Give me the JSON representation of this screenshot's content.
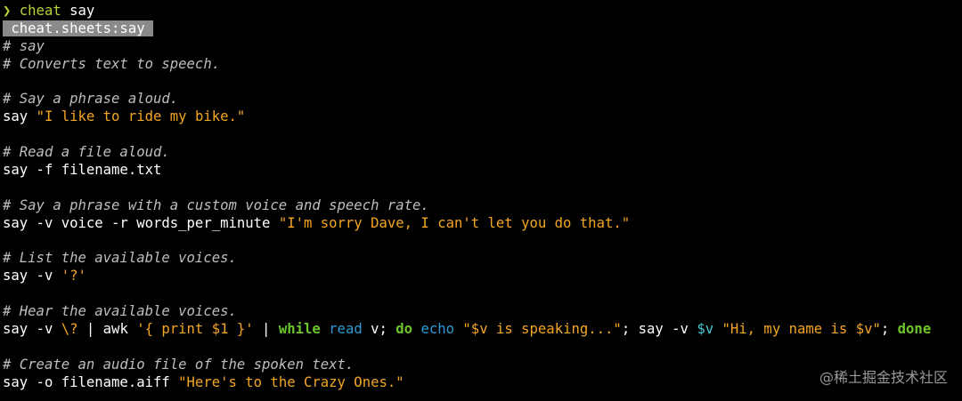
{
  "prompt": {
    "arrow": "❯",
    "command": "cheat",
    "argument": " say"
  },
  "sheet_header": " cheat.sheets:say ",
  "lines": {
    "title_comment": "# say",
    "desc_comment": "# Converts text to speech.",
    "c1": "# Say a phrase aloud.",
    "l1_cmd": "say ",
    "l1_str": "\"I like to ride my bike.\"",
    "c2": "# Read a file aloud.",
    "l2_cmd": "say -f filename.txt",
    "c3": "# Say a phrase with a custom voice and speech rate.",
    "l3_cmd": "say -v voice -r words_per_minute ",
    "l3_str": "\"I'm sorry Dave, I can't let you do that.\"",
    "c4": "# List the available voices.",
    "l4_cmd": "say -v ",
    "l4_str": "'?'",
    "c5": "# Hear the available voices.",
    "l5_a": "say -v ",
    "l5_esc": "\\?",
    "l5_b": " | awk ",
    "l5_awk": "'{ print $1 }'",
    "l5_c": " | ",
    "l5_while": "while",
    "l5_sp1": " ",
    "l5_read": "read",
    "l5_d": " v; ",
    "l5_do": "do",
    "l5_sp2": " ",
    "l5_echo": "echo",
    "l5_sp3": " ",
    "l5_str1": "\"$v is speaking...\"",
    "l5_e": "; say -v ",
    "l5_var": "$v",
    "l5_sp4": " ",
    "l5_str2": "\"Hi, my name is $v\"",
    "l5_f": "; ",
    "l5_done": "done",
    "c6": "# Create an audio file of the spoken text.",
    "l6_cmd": "say -o filename.aiff ",
    "l6_str": "\"Here's to the Crazy Ones.\""
  },
  "watermark": "@稀土掘金技术社区",
  "colors": {
    "background": "#000000",
    "prompt": "#b5d334",
    "comment": "#bebebe",
    "string": "#f3a623",
    "keyword_green": "#6cc52b",
    "keyword_blue": "#2f9ad6",
    "variable": "#48c8d4",
    "header_bg": "#8a8a8a"
  }
}
